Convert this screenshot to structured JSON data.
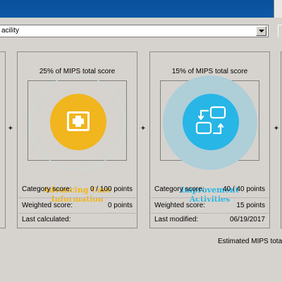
{
  "window": {
    "title_bar_color": "#0d5aa8"
  },
  "filter": {
    "selected": "acility"
  },
  "cards": [
    {
      "header": "25% of MIPS total score",
      "icon": "first-aid-kit-icon",
      "accent": "#f1b51d",
      "name_line1": "Advancing Care",
      "name_line2": "Information",
      "category_label": "Category score:",
      "category_value": "0 / 100 points",
      "weighted_label": "Weighted score:",
      "weighted_value": "0 points",
      "date_label": "Last calculated:",
      "date_value": ""
    },
    {
      "header": "15% of MIPS total score",
      "icon": "cycle-arrows-icon",
      "accent": "#27b6e6",
      "name_line1": "Improvement",
      "name_line2": "Activities",
      "category_label": "Category score:",
      "category_value": "40 / 40 points",
      "weighted_label": "Weighted score:",
      "weighted_value": "15 points",
      "date_label": "Last modified:",
      "date_value": "06/19/2017"
    }
  ],
  "plus_signs": [
    "+",
    "+",
    "+"
  ],
  "footer": {
    "estimated_label": "Estimated MIPS tota"
  }
}
